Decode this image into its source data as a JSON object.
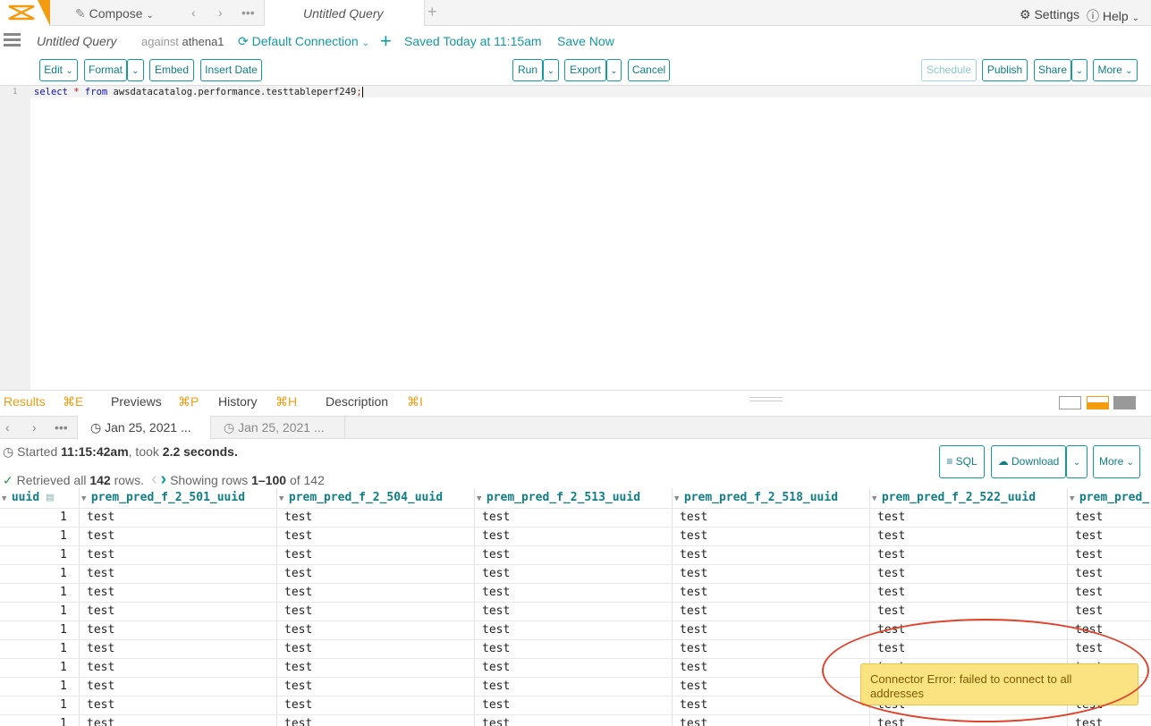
{
  "topbar": {
    "compose_label": "Compose",
    "tab_title": "Untitled Query",
    "settings_label": "Settings",
    "help_label": "Help"
  },
  "querybar": {
    "title": "Untitled Query",
    "against_prefix": "against",
    "database": "athena1",
    "connection": "Default Connection",
    "saved": "Saved Today at 11:15am",
    "save_now": "Save Now"
  },
  "toolbar": {
    "edit": "Edit",
    "format": "Format",
    "embed": "Embed",
    "insert_date": "Insert Date",
    "run": "Run",
    "export": "Export",
    "cancel": "Cancel",
    "schedule": "Schedule",
    "publish": "Publish",
    "share": "Share",
    "more": "More"
  },
  "editor": {
    "line_number": "1",
    "kw_select": "select",
    "star": "*",
    "kw_from": "from",
    "table": "awsdatacatalog.performance.testtableperf249",
    "semicolon": ";"
  },
  "results_tabs": {
    "results": "Results",
    "results_key": "⌘E",
    "previews": "Previews",
    "previews_key": "⌘P",
    "history": "History",
    "history_key": "⌘H",
    "description": "Description",
    "description_key": "⌘I"
  },
  "subtabs": [
    "Jan 25, 2021 ...",
    "Jan 25, 2021 ..."
  ],
  "status": {
    "started_prefix": "Started",
    "started_time": "11:15:42am",
    "took_prefix": ", took",
    "took_value": "2.2 seconds.",
    "retrieved_prefix": "Retrieved all",
    "row_count": "142",
    "retrieved_suffix": "rows.",
    "showing_prefix": "Showing rows",
    "showing_range": "1–100",
    "showing_suffix": "of 142"
  },
  "result_buttons": {
    "sql": "SQL",
    "download": "Download",
    "more": "More"
  },
  "grid": {
    "headers": [
      "uuid",
      "prem_pred_f_2_501_uuid",
      "prem_pred_f_2_504_uuid",
      "prem_pred_f_2_513_uuid",
      "prem_pred_f_2_518_uuid",
      "prem_pred_f_2_522_uuid",
      "prem_pred_"
    ],
    "uuid_value": "1",
    "cell_value": "test",
    "visible_rows": 12
  },
  "toast": {
    "message": "Connector Error: failed to connect to all addresses"
  },
  "colors": {
    "accent": "#139aa1",
    "brand_orange": "#f39c12",
    "toast_bg": "#fce382",
    "annotation_red": "#e0442c"
  }
}
